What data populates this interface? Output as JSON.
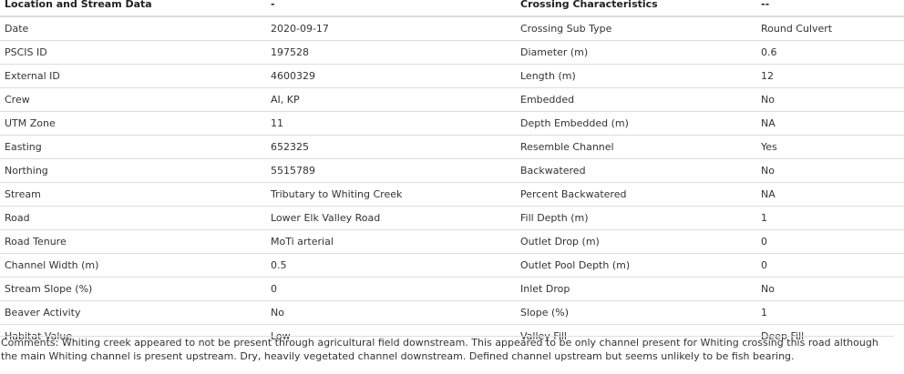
{
  "headers": [
    "Location and Stream Data",
    "-",
    "Crossing Characteristics",
    "--"
  ],
  "rows": [
    [
      "Date",
      "2020-09-17",
      "Crossing Sub Type",
      "Round Culvert"
    ],
    [
      "PSCIS ID",
      "197528",
      "Diameter (m)",
      "0.6"
    ],
    [
      "External ID",
      "4600329",
      "Length (m)",
      "12"
    ],
    [
      "Crew",
      "AI, KP",
      "Embedded",
      "No"
    ],
    [
      "UTM Zone",
      "11",
      "Depth Embedded (m)",
      "NA"
    ],
    [
      "Easting",
      "652325",
      "Resemble Channel",
      "Yes"
    ],
    [
      "Northing",
      "5515789",
      "Backwatered",
      "No"
    ],
    [
      "Stream",
      "Tributary to Whiting Creek",
      "Percent Backwatered",
      "NA"
    ],
    [
      "Road",
      "Lower Elk Valley Road",
      "Fill Depth (m)",
      "1"
    ],
    [
      "Road Tenure",
      "MoTi arterial",
      "Outlet Drop (m)",
      "0"
    ],
    [
      "Channel Width (m)",
      "0.5",
      "Outlet Pool Depth (m)",
      "0"
    ],
    [
      "Stream Slope (%)",
      "0",
      "Inlet Drop",
      "No"
    ],
    [
      "Beaver Activity",
      "No",
      "Slope (%)",
      "1"
    ],
    [
      "Habitat Value",
      "Low",
      "Valley Fill",
      "Deep Fill"
    ]
  ],
  "comments": "Comments: Whiting creek appeared to not be present through agricultural field downstream. This appeared to be only channel present for Whiting crossing this road although the main Whiting channel is present upstream. Dry, heavily vegetated channel downstream. Defined channel upstream but seems unlikely to be fish bearing."
}
